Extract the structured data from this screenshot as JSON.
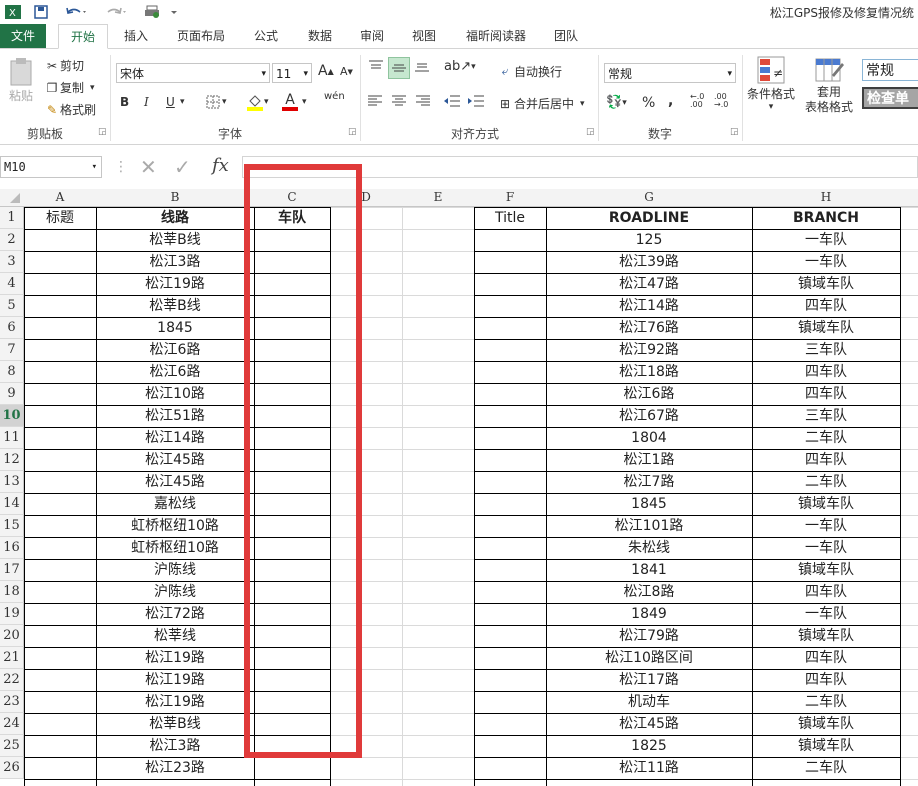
{
  "window": {
    "title": "松江GPS报修及修复情况统"
  },
  "ribbon": {
    "tabs": [
      "文件",
      "开始",
      "插入",
      "页面布局",
      "公式",
      "数据",
      "审阅",
      "视图",
      "福昕阅读器",
      "团队"
    ],
    "clipboard": {
      "paste": "粘贴",
      "cut": "剪切",
      "copy": "复制",
      "format_painter": "格式刷",
      "label": "剪贴板"
    },
    "font": {
      "name": "宋体",
      "size": "11",
      "label": "字体",
      "bold": "B",
      "italic": "I",
      "underline": "U",
      "grow": "A",
      "shrink": "A",
      "color": "A",
      "phonetic": "wén"
    },
    "alignment": {
      "wrap": "自动换行",
      "merge": "合并后居中",
      "label": "对齐方式"
    },
    "number": {
      "format": "常规",
      "label": "数字",
      "percent": "%",
      "comma": ","
    },
    "styles": {
      "conditional": "条件格式",
      "table_style": "套用\n表格格式",
      "style_normal": "常规",
      "style_check": "检查单"
    }
  },
  "formula_bar": {
    "name_box": "M10",
    "fx": "fx"
  },
  "columns": [
    "A",
    "B",
    "C",
    "D",
    "E",
    "F",
    "G",
    "H"
  ],
  "rows": [
    "1",
    "2",
    "3",
    "4",
    "5",
    "6",
    "7",
    "8",
    "9",
    "10",
    "11",
    "12",
    "13",
    "14",
    "15",
    "16",
    "17",
    "18",
    "19",
    "20",
    "21",
    "22",
    "23",
    "24",
    "25",
    "26"
  ],
  "left_table": {
    "headers": [
      "标题",
      "线路",
      "车队"
    ],
    "routes": [
      "松莘B线",
      "松江3路",
      "松江19路",
      "松莘B线",
      "1845",
      "松江6路",
      "松江6路",
      "松江10路",
      "松江51路",
      "松江14路",
      "松江45路",
      "松江45路",
      "嘉松线",
      "虹桥枢纽10路",
      "虹桥枢纽10路",
      "沪陈线",
      "沪陈线",
      "松江72路",
      "松莘线",
      "松江19路",
      "松江19路",
      "松江19路",
      "松莘B线",
      "松江3路",
      "松江23路"
    ]
  },
  "right_table": {
    "headers": [
      "Title",
      "ROADLINE",
      "BRANCH"
    ],
    "rows": [
      [
        "125",
        "一车队"
      ],
      [
        "松江39路",
        "一车队"
      ],
      [
        "松江47路",
        "镇域车队"
      ],
      [
        "松江14路",
        "四车队"
      ],
      [
        "松江76路",
        "镇域车队"
      ],
      [
        "松江92路",
        "三车队"
      ],
      [
        "松江18路",
        "四车队"
      ],
      [
        "松江6路",
        "四车队"
      ],
      [
        "松江67路",
        "三车队"
      ],
      [
        "1804",
        "二车队"
      ],
      [
        "松江1路",
        "四车队"
      ],
      [
        "松江7路",
        "二车队"
      ],
      [
        "1845",
        "镇域车队"
      ],
      [
        "松江101路",
        "一车队"
      ],
      [
        "朱松线",
        "一车队"
      ],
      [
        "1841",
        "镇域车队"
      ],
      [
        "松江8路",
        "四车队"
      ],
      [
        "1849",
        "一车队"
      ],
      [
        "松江79路",
        "镇域车队"
      ],
      [
        "松江10路区间",
        "四车队"
      ],
      [
        "松江17路",
        "四车队"
      ],
      [
        "机动车",
        "二车队"
      ],
      [
        "松江45路",
        "镇域车队"
      ],
      [
        "1825",
        "镇域车队"
      ],
      [
        "松江11路",
        "二车队"
      ]
    ]
  },
  "colors": {
    "accent": "#217346",
    "highlight": "#e03a3a"
  }
}
